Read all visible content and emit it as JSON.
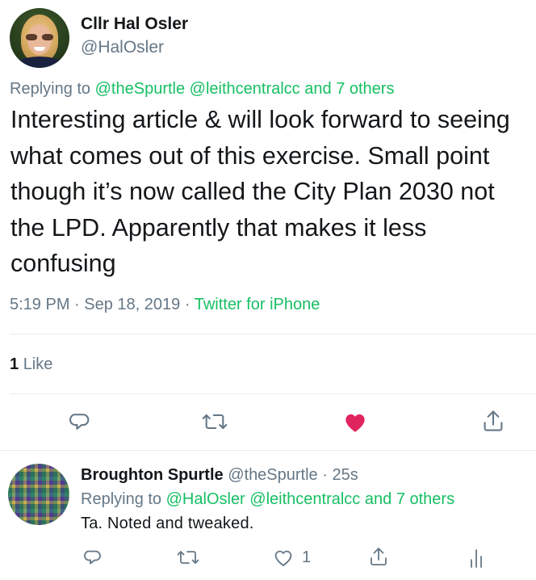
{
  "tweet": {
    "display_name": "Cllr Hal Osler",
    "handle": "@HalOsler",
    "replying_label": "Replying to",
    "replying_mentions": "@theSpurtle @leithcentralcc",
    "replying_and": "and",
    "replying_others": "7 others",
    "text": "Interesting article & will look forward to seeing what comes out of this exercise. Small point though it’s now called the City Plan 2030 not the LPD. Apparently that makes it less confusing",
    "time": "5:19 PM",
    "date": "Sep 18, 2019",
    "separator": "·",
    "source": "Twitter for iPhone",
    "like_count": "1",
    "like_label": "Like",
    "liked": true,
    "colors": {
      "accent": "#17bf63",
      "like": "#e0245e",
      "muted": "#657786"
    }
  },
  "actions": {
    "icons": [
      "reply-icon",
      "retweet-icon",
      "like-icon",
      "share-icon"
    ]
  },
  "reply": {
    "display_name": "Broughton Spurtle",
    "handle": "@theSpurtle",
    "separator": "·",
    "age": "25s",
    "replying_label": "Replying to",
    "replying_mentions": "@HalOsler @leithcentralcc",
    "replying_and": "and",
    "replying_others": "7 others",
    "text": "Ta. Noted and tweaked.",
    "like_count": "1",
    "icons": [
      "reply-icon",
      "retweet-icon",
      "like-icon",
      "share-icon",
      "analytics-icon"
    ]
  }
}
